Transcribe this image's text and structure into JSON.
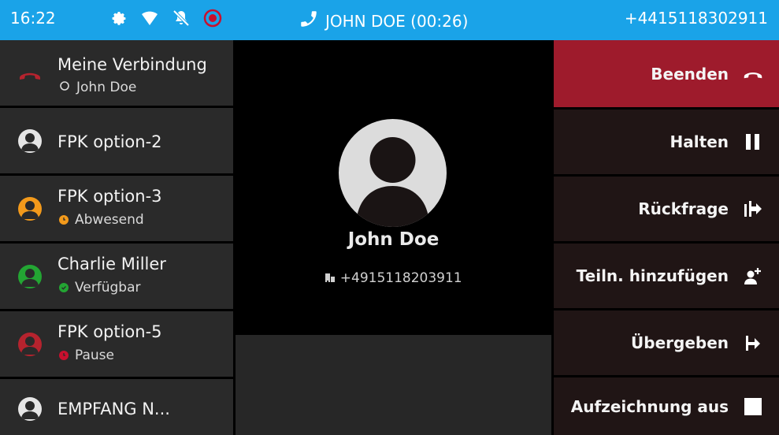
{
  "statusbar": {
    "time": "16:22",
    "call_label": "JOHN DOE (00:26)",
    "number": "+4415118302911",
    "icons": [
      "gear-icon",
      "wifi-icon",
      "bell-muted-icon",
      "record-icon"
    ]
  },
  "list": [
    {
      "title": "Meine Verbindung",
      "subtitle": "John Doe",
      "status_icon": "ring-icon",
      "avatar_icon": "handset-down-icon",
      "color": "#b5232e"
    },
    {
      "title": "FPK option-2",
      "subtitle": "",
      "avatar_icon": "person-icon",
      "color": "#e6e6e6"
    },
    {
      "title": "FPK option-3",
      "subtitle": "Abwesend",
      "status_icon": "clock-icon",
      "avatar_icon": "person-icon",
      "color": "#f39a1b"
    },
    {
      "title": "Charlie Miller",
      "subtitle": "Verfügbar",
      "status_icon": "check-icon",
      "avatar_icon": "person-icon",
      "color": "#23a533"
    },
    {
      "title": "FPK option-5",
      "subtitle": "Pause",
      "status_icon": "clock-icon",
      "avatar_icon": "person-icon",
      "color": "#b5232e"
    },
    {
      "title": "EMPFANG N...",
      "subtitle": "",
      "avatar_icon": "person-icon",
      "color": "#e6e6e6"
    }
  ],
  "contact": {
    "name": "John Doe",
    "phone": "+4915118203911",
    "phone_icon": "building-icon"
  },
  "actions": [
    {
      "label": "Beenden",
      "icon": "hangup-icon",
      "color": "#9e1b2c"
    },
    {
      "label": "Halten",
      "icon": "pause-icon"
    },
    {
      "label": "Rückfrage",
      "icon": "consult-icon"
    },
    {
      "label": "Teiln. hinzufügen",
      "icon": "add-participant-icon"
    },
    {
      "label": "Übergeben",
      "icon": "transfer-icon"
    },
    {
      "label": "Aufzeichnung aus",
      "icon": "stop-icon"
    }
  ]
}
